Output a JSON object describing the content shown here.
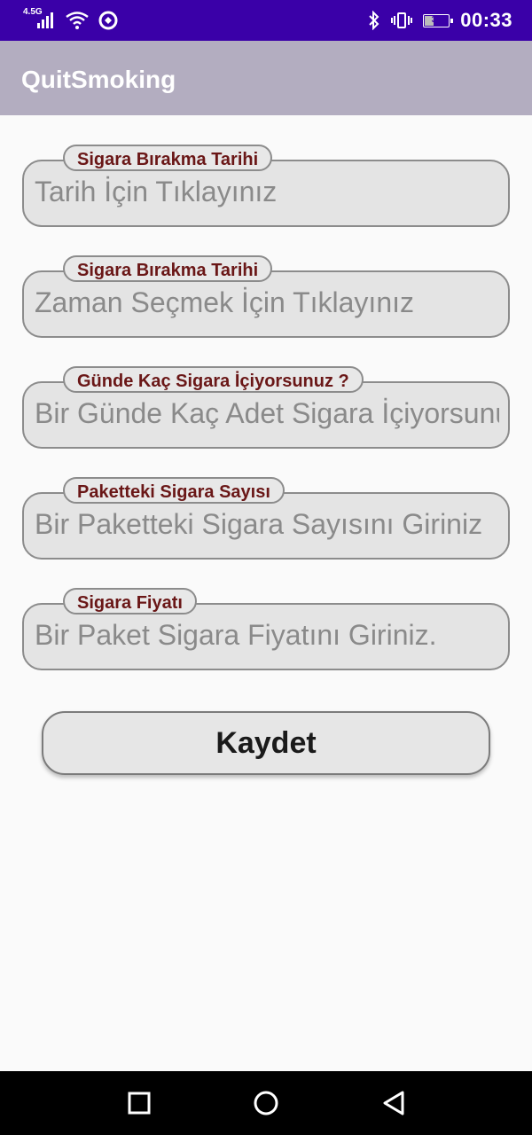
{
  "status_bar": {
    "network_type": "4.5G",
    "battery_level": "39",
    "time": "00:33",
    "icons": [
      "signal-icon",
      "wifi-icon",
      "sync-icon",
      "bluetooth-icon",
      "vibrate-icon",
      "battery-icon"
    ]
  },
  "app_bar": {
    "title": "QuitSmoking"
  },
  "fields": [
    {
      "label": "Sigara Bırakma Tarihi",
      "placeholder": "Tarih İçin Tıklayınız"
    },
    {
      "label": "Sigara Bırakma Tarihi",
      "placeholder": "Zaman Seçmek İçin Tıklayınız"
    },
    {
      "label": "Günde Kaç Sigara İçiyorsunuz ?",
      "placeholder": "Bir Günde Kaç Adet Sigara İçiyorsunuz"
    },
    {
      "label": "Paketteki Sigara Sayısı",
      "placeholder": "Bir Paketteki Sigara Sayısını Giriniz"
    },
    {
      "label": "Sigara Fiyatı",
      "placeholder": "Bir Paket Sigara Fiyatını Giriniz."
    }
  ],
  "save_button": {
    "label": "Kaydet"
  },
  "nav_bar": {
    "icons": [
      "recents-icon",
      "home-icon",
      "back-icon"
    ]
  },
  "colors": {
    "status_bar": "#3a00a8",
    "app_bar": "#b3adc0",
    "label_text": "#6a1717"
  }
}
